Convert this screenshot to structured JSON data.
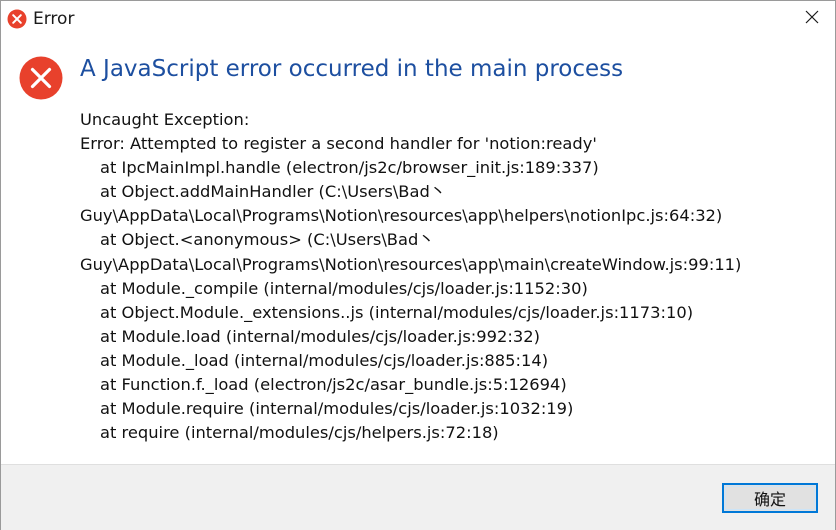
{
  "window": {
    "title": "Error"
  },
  "dialog": {
    "heading": "A JavaScript error occurred in the main process",
    "message_lines": [
      {
        "text": "Uncaught Exception:",
        "indent": false
      },
      {
        "text": "Error: Attempted to register a second handler for 'notion:ready'",
        "indent": false
      },
      {
        "text": "at IpcMainImpl.handle (electron/js2c/browser_init.js:189:337)",
        "indent": true
      },
      {
        "text": "at Object.addMainHandler (C:\\Users\\Bad丶",
        "indent": true
      },
      {
        "text": "Guy\\AppData\\Local\\Programs\\Notion\\resources\\app\\helpers\\notionIpc.js:64:32)",
        "indent": false
      },
      {
        "text": "at Object.<anonymous> (C:\\Users\\Bad丶",
        "indent": true
      },
      {
        "text": "Guy\\AppData\\Local\\Programs\\Notion\\resources\\app\\main\\createWindow.js:99:11)",
        "indent": false
      },
      {
        "text": "at Module._compile (internal/modules/cjs/loader.js:1152:30)",
        "indent": true
      },
      {
        "text": "at Object.Module._extensions..js (internal/modules/cjs/loader.js:1173:10)",
        "indent": true
      },
      {
        "text": "at Module.load (internal/modules/cjs/loader.js:992:32)",
        "indent": true
      },
      {
        "text": "at Module._load (internal/modules/cjs/loader.js:885:14)",
        "indent": true
      },
      {
        "text": "at Function.f._load (electron/js2c/asar_bundle.js:5:12694)",
        "indent": true
      },
      {
        "text": "at Module.require (internal/modules/cjs/loader.js:1032:19)",
        "indent": true
      },
      {
        "text": "at require (internal/modules/cjs/helpers.js:72:18)",
        "indent": true
      }
    ],
    "ok_label": "确定"
  },
  "icons": {
    "title_icon": "error-icon",
    "heading_icon": "error-icon",
    "close_icon": "close-icon"
  },
  "colors": {
    "error_red": "#e8412c",
    "heading_blue": "#1d4fa0",
    "button_border": "#0078d7",
    "footer_bg": "#f0f0f0"
  }
}
